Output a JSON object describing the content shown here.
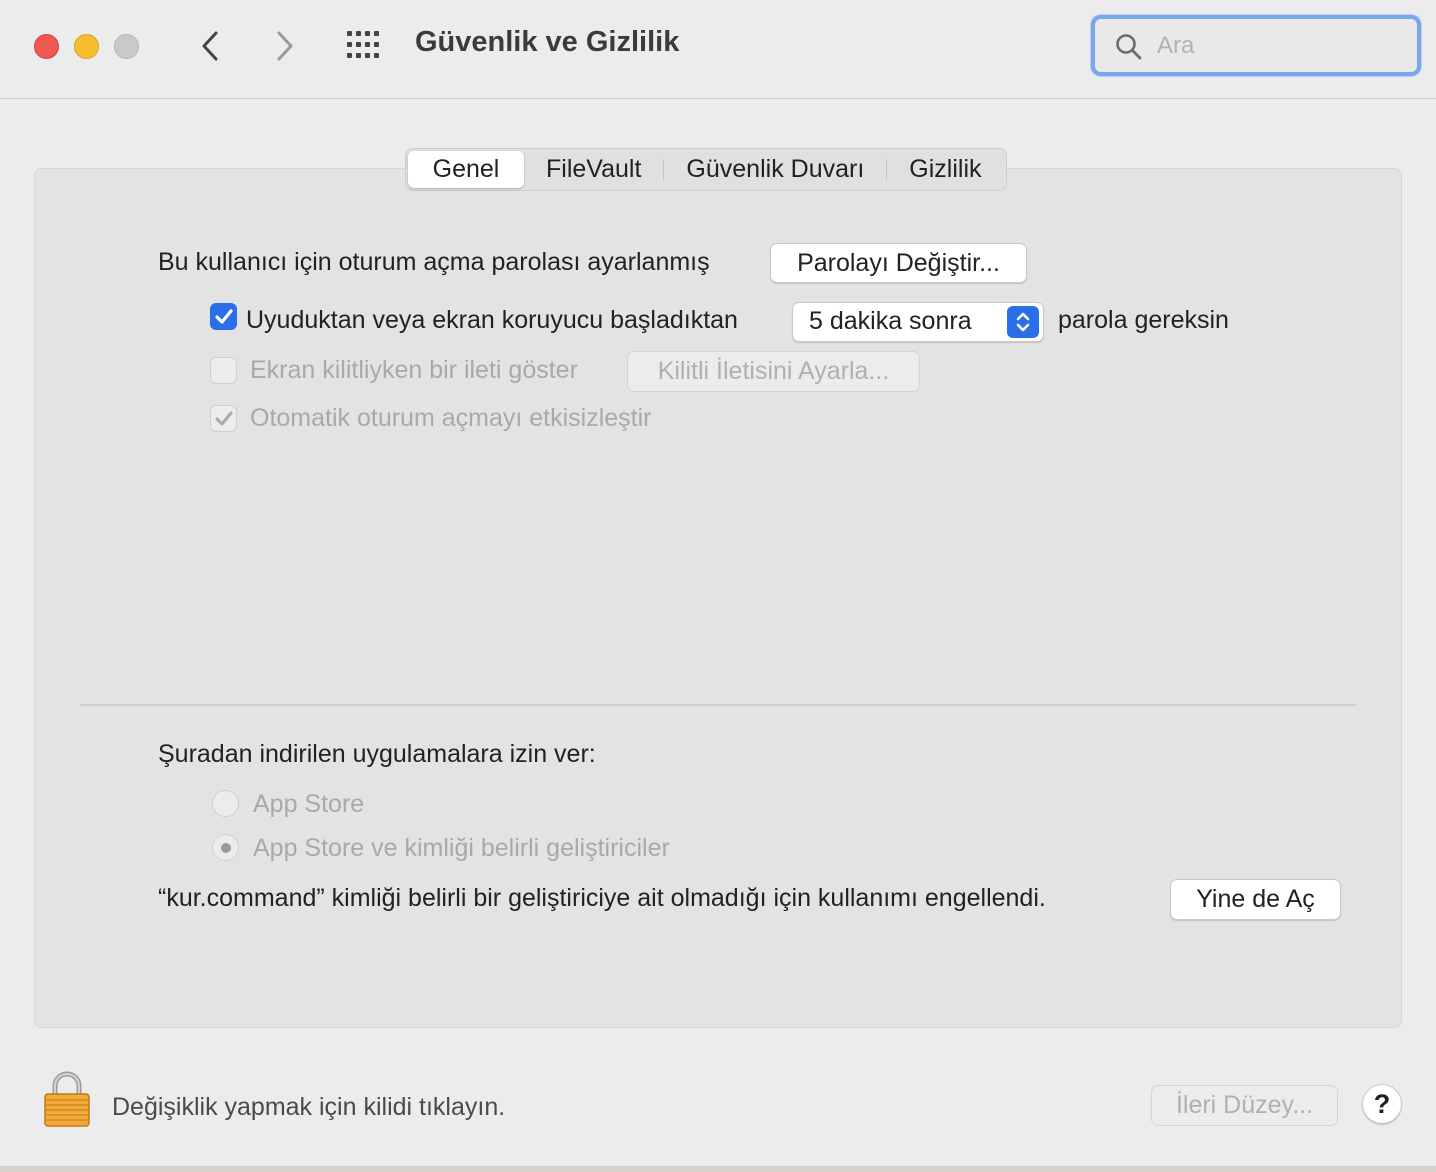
{
  "window": {
    "title": "Güvenlik ve Gizlilik",
    "search_placeholder": "Ara"
  },
  "tabs": [
    {
      "label": "Genel",
      "active": true
    },
    {
      "label": "FileVault",
      "active": false
    },
    {
      "label": "Güvenlik Duvarı",
      "active": false
    },
    {
      "label": "Gizlilik",
      "active": false
    }
  ],
  "general": {
    "password_status": "Bu kullanıcı için oturum açma parolası ayarlanmış",
    "change_password_button": "Parolayı Değiştir...",
    "require_password": {
      "checked": true,
      "label_before": "Uyuduktan veya ekran koruyucu başladıktan",
      "delay_value": "5 dakika sonra",
      "label_after": "parola gereksin"
    },
    "lock_message": {
      "checked": false,
      "enabled": false,
      "label": "Ekran kilitliyken bir ileti göster",
      "button": "Kilitli İletisini Ayarla..."
    },
    "disable_auto_login": {
      "checked": true,
      "enabled": false,
      "label": "Otomatik oturum açmayı etkisizleştir"
    }
  },
  "downloads": {
    "heading": "Şuradan indirilen uygulamalara izin ver:",
    "options": [
      {
        "label": "App Store",
        "selected": false
      },
      {
        "label": "App Store ve kimliği belirli geliştiriciler",
        "selected": true
      }
    ],
    "blocked_message": "“kur.command” kimliği belirli bir geliştiriciye ait olmadığı için kullanımı engellendi.",
    "open_anyway_button": "Yine de Aç"
  },
  "footer": {
    "lock_text": "Değişiklik yapmak için kilidi tıklayın.",
    "advanced_button": "İleri Düzey...",
    "help_label": "?"
  },
  "colors": {
    "accent": "#2a6fe8",
    "close": "#ee5a52",
    "minimize": "#f6bd2f",
    "zoom_disabled": "#c9c9c9",
    "search_focus": "#7aa6ea"
  }
}
